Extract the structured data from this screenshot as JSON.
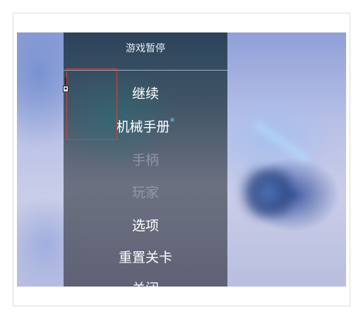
{
  "pause_menu": {
    "title": "游戏暂停",
    "items": [
      {
        "label": "继续",
        "enabled": true,
        "badge": ""
      },
      {
        "label": "机械手册",
        "enabled": true,
        "badge": "*"
      },
      {
        "label": "手柄",
        "enabled": false,
        "badge": ""
      },
      {
        "label": "玩家",
        "enabled": false,
        "badge": ""
      },
      {
        "label": "选项",
        "enabled": true,
        "badge": ""
      },
      {
        "label": "重置关卡",
        "enabled": true,
        "badge": ""
      },
      {
        "label": "关闭",
        "enabled": true,
        "badge": ""
      }
    ]
  },
  "colors": {
    "highlight_box": "#d9403a",
    "badge": "#5fd3e0"
  },
  "icons": {
    "cursor": "mouse-pointer-icon",
    "background_object": "blurred-robot-icon"
  }
}
